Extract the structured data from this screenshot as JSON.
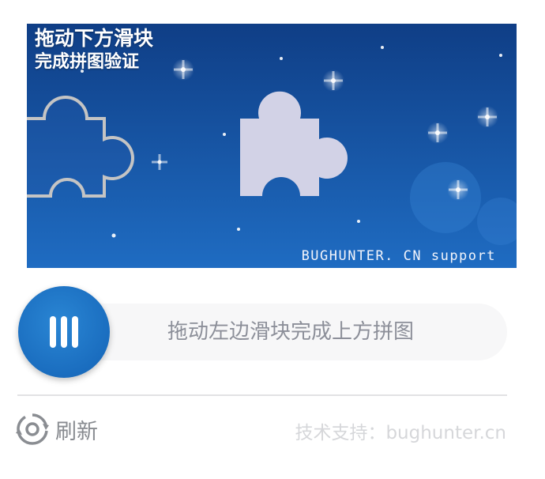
{
  "puzzle": {
    "title_line1": "拖动下方滑块",
    "title_line2": "完成拼图验证",
    "watermark": "BUGHUNTER. CN support",
    "colors": {
      "sky_top": "#0f3e86",
      "sky_bottom": "#1f6cc2",
      "piece_fill": "#d2d2e6",
      "piece_outline": "#c4c4c4"
    }
  },
  "slider": {
    "hint": "拖动左边滑块完成上方拼图",
    "progress": 0,
    "colors": {
      "handle": "#1a6dbf",
      "track": "#f7f7f8"
    }
  },
  "footer": {
    "refresh_label": "刷新",
    "refresh_icon": "refresh-icon",
    "support_text": "技术支持：bughunter.cn"
  }
}
